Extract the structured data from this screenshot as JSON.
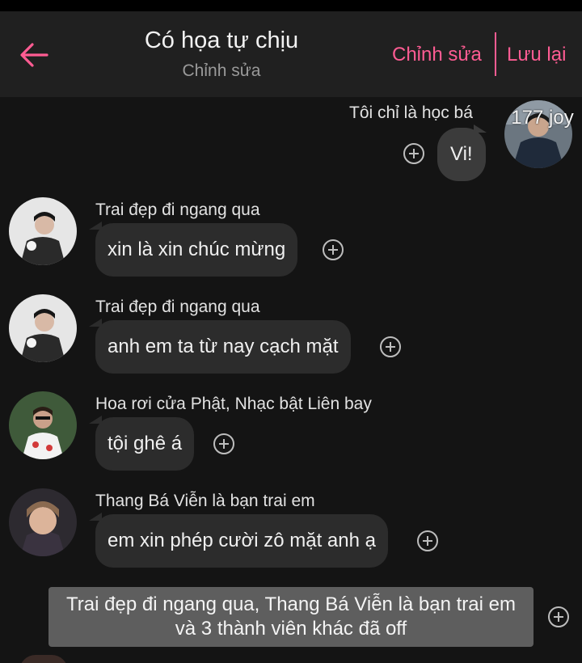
{
  "header": {
    "title": "Có họa tự chịu",
    "subtitle": "Chỉnh sửa",
    "edit_label": "Chỉnh sửa",
    "save_label": "Lưu lại"
  },
  "colors": {
    "accent": "#ff5c93",
    "background": "#141414",
    "header": "#202020",
    "bubble": "#2c2c2c"
  },
  "own_message": {
    "sender": "Tôi chỉ là học bá",
    "text": "Vi!",
    "avatar_label": "177 joy"
  },
  "messages": [
    {
      "sender": "Trai đẹp đi ngang qua",
      "text": "xin là xin chúc mừng"
    },
    {
      "sender": "Trai đẹp đi ngang qua",
      "text": "anh em ta từ nay cạch mặt"
    },
    {
      "sender": "Hoa rơi cửa Phật, Nhạc bật Liên bay",
      "text": "tội ghê á"
    },
    {
      "sender": "Thang Bá Viễn là bạn trai em",
      "text": "em xin phép cười zô mặt anh ạ"
    }
  ],
  "system_notice": "Trai đẹp đi ngang qua, Thang Bá Viễn là bạn trai em và 3 thành viên khác đã off",
  "icons": {
    "back": "arrow-left-icon",
    "react": "add-reaction-icon"
  }
}
